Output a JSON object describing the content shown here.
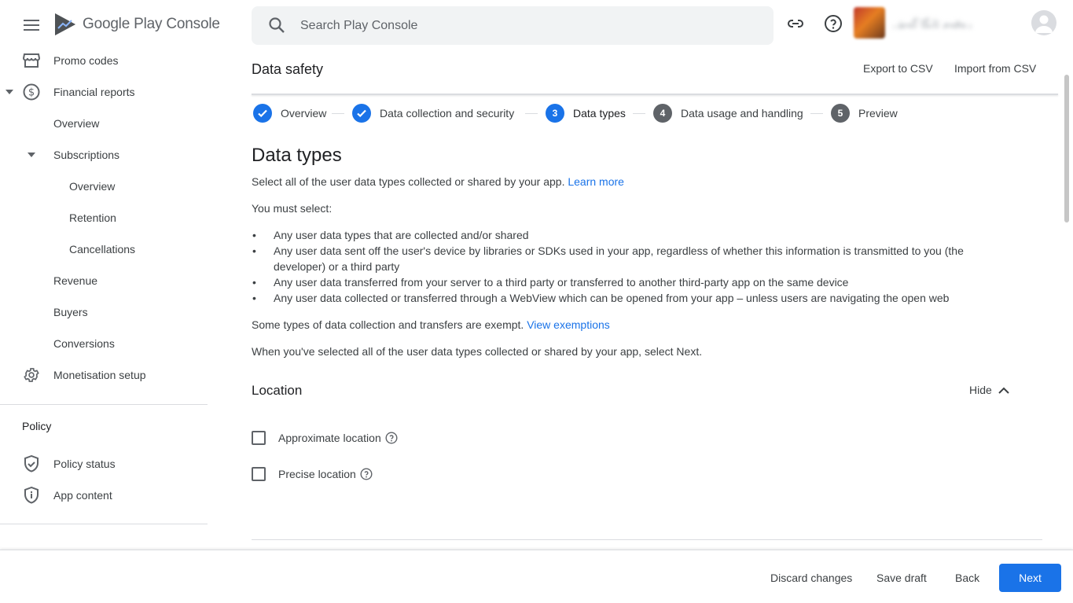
{
  "brand": {
    "name_first": "Google Play",
    "name_second": "Console"
  },
  "sidebar": {
    "items": [
      {
        "label": "Promo codes",
        "icon": "store-icon"
      },
      {
        "label": "Financial reports",
        "icon": "dollar-circle-icon"
      },
      {
        "label": "Overview"
      },
      {
        "label": "Subscriptions"
      },
      {
        "label": "Overview"
      },
      {
        "label": "Retention"
      },
      {
        "label": "Cancellations"
      },
      {
        "label": "Revenue"
      },
      {
        "label": "Buyers"
      },
      {
        "label": "Conversions"
      },
      {
        "label": "Monetisation setup",
        "icon": "gear-icon"
      }
    ],
    "policy_section": "Policy",
    "policy_items": [
      {
        "label": "Policy status",
        "icon": "shield-check-icon"
      },
      {
        "label": "App content",
        "icon": "shield-info-icon"
      }
    ]
  },
  "search": {
    "placeholder": "Search Play Console",
    "value": ""
  },
  "topbar": {
    "link_icon": "link-icon",
    "help_icon": "help-circle-icon",
    "developer_name": "رەقەم ئابگا گەش"
  },
  "page": {
    "title": "Data safety",
    "export_label": "Export to CSV",
    "import_label": "Import from CSV"
  },
  "stepper": [
    {
      "num": "1",
      "label": "Overview",
      "state": "done"
    },
    {
      "num": "2",
      "label": "Data collection and security",
      "state": "done"
    },
    {
      "num": "3",
      "label": "Data types",
      "state": "active"
    },
    {
      "num": "4",
      "label": "Data usage and handling",
      "state": "todo"
    },
    {
      "num": "5",
      "label": "Preview",
      "state": "todo"
    }
  ],
  "content": {
    "heading": "Data types",
    "intro": "Select all of the user data types collected or shared by your app. ",
    "learn_more": "Learn more",
    "must_select": "You must select:",
    "bullets": [
      "Any user data types that are collected and/or shared",
      "Any user data sent off the user's device by libraries or SDKs used in your app, regardless of whether this information is transmitted to you (the developer) or a third party",
      "Any user data transferred from your server to a third party or transferred to another third-party app on the same device",
      "Any user data collected or transferred through a WebView which can be opened from your app – unless users are navigating the open web"
    ],
    "exempt_text": "Some types of data collection and transfers are exempt. ",
    "view_exemptions": "View exemptions",
    "when_done": "When you've selected all of the user data types collected or shared by your app, select Next."
  },
  "location": {
    "title": "Location",
    "hide_label": "Hide",
    "options": [
      {
        "label": "Approximate location",
        "checked": false
      },
      {
        "label": "Precise location",
        "checked": false
      }
    ]
  },
  "footer": {
    "discard": "Discard changes",
    "save": "Save draft",
    "back": "Back",
    "next": "Next"
  },
  "colors": {
    "accent": "#1a73e8",
    "text": "#3c4043",
    "muted": "#5f6368",
    "divider": "#dadce0"
  }
}
